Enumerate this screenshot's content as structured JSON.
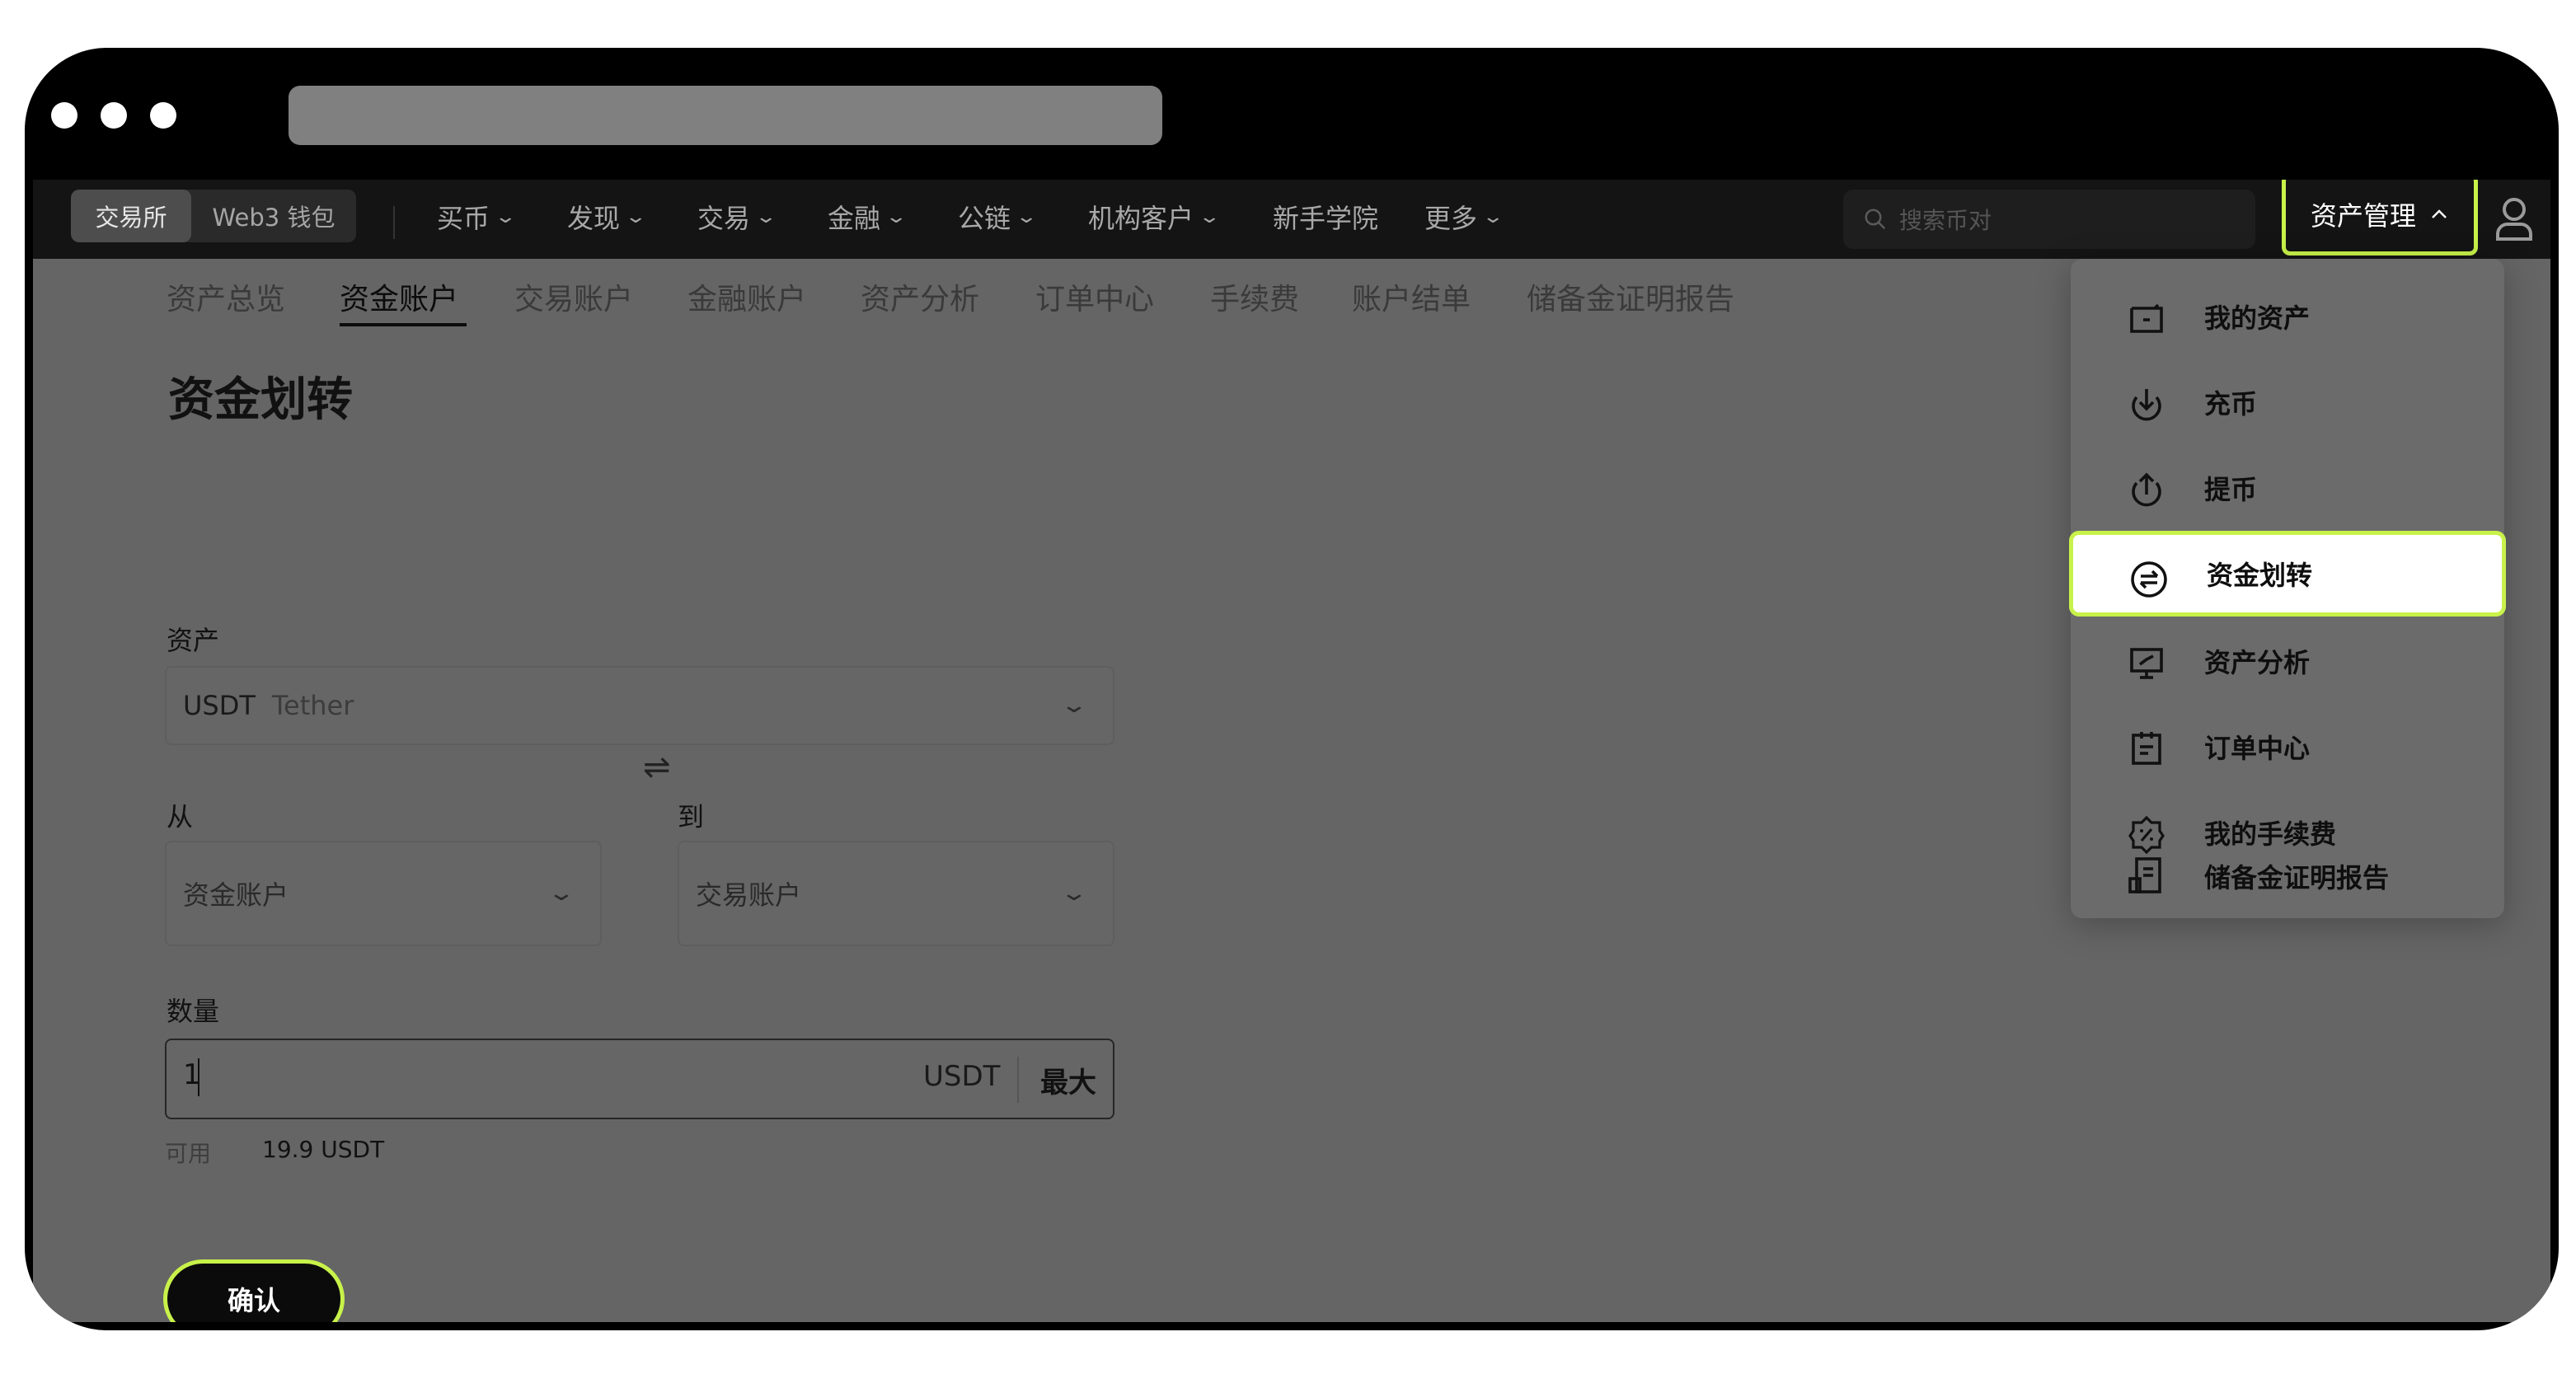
{
  "nav": {
    "segment": [
      "交易所",
      "Web3 钱包"
    ],
    "items": [
      "买币",
      "发现",
      "交易",
      "金融",
      "公链",
      "机构客户",
      "新手学院",
      "更多"
    ],
    "search_placeholder": "搜索币对",
    "asset_mgmt": "资产管理"
  },
  "tabs": [
    "资产总览",
    "资金账户",
    "交易账户",
    "金融账户",
    "资产分析",
    "订单中心",
    "手续费",
    "账户结单",
    "储备金证明报告"
  ],
  "form": {
    "title": "资金划转",
    "asset_label": "资产",
    "asset_symbol": "USDT",
    "asset_name": "Tether",
    "from_label": "从",
    "to_label": "到",
    "from_value": "资金账户",
    "to_value": "交易账户",
    "swap_symbol": "⇌",
    "qty_label": "数量",
    "qty_value": "1",
    "qty_unit": "USDT",
    "max_label": "最大",
    "available_label": "可用",
    "available_value": "19.9 USDT",
    "confirm_label": "确认"
  },
  "menu": [
    "我的资产",
    "充币",
    "提币",
    "资金划转",
    "资产分析",
    "订单中心",
    "我的手续费",
    "储备金证明报告"
  ],
  "colors": {
    "accent": "#c8f24a",
    "frame": "#000000",
    "overlay": "#656565"
  }
}
